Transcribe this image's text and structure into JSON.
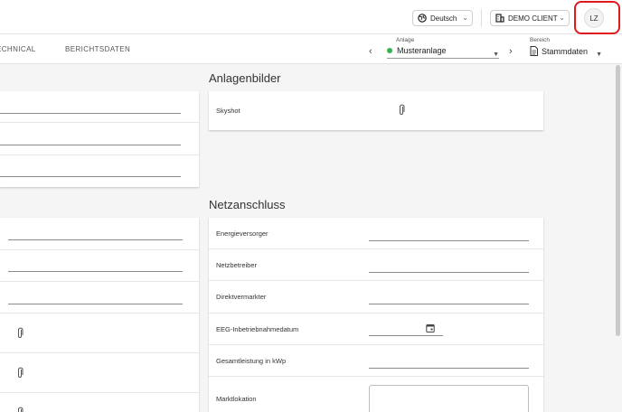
{
  "topbar": {
    "language": "Deutsch",
    "client": "DEMO CLIENT",
    "avatar_initials": "LZ"
  },
  "tabs": [
    "ECHNICAL",
    "BERICHTSDATEN"
  ],
  "anlage": {
    "label": "Anlage",
    "value": "Musteranlage",
    "status_color": "#35b34a"
  },
  "bereich": {
    "label": "Bereich",
    "value": "Stammdaten"
  },
  "sections": {
    "bilder": {
      "title": "Anlagenbilder",
      "rows": [
        {
          "label": "Skyshot"
        }
      ]
    },
    "netz": {
      "title": "Netzanschluss",
      "rows": [
        {
          "label": "Energieversorger"
        },
        {
          "label": "Netzbetreiber"
        },
        {
          "label": "Direktvermarkter"
        },
        {
          "label": "EEG-Inbetriebnahmedatum"
        },
        {
          "label": "Gesamtleistung in kWp"
        },
        {
          "label": "Marktlokation"
        }
      ]
    }
  },
  "icons": {
    "language": "globe-icon",
    "client": "building-icon",
    "attachment": "paperclip-icon",
    "calendar": "calendar-icon",
    "document": "document-icon"
  },
  "colors": {
    "highlight": "#e0191f",
    "accent_green": "#35b34a"
  }
}
